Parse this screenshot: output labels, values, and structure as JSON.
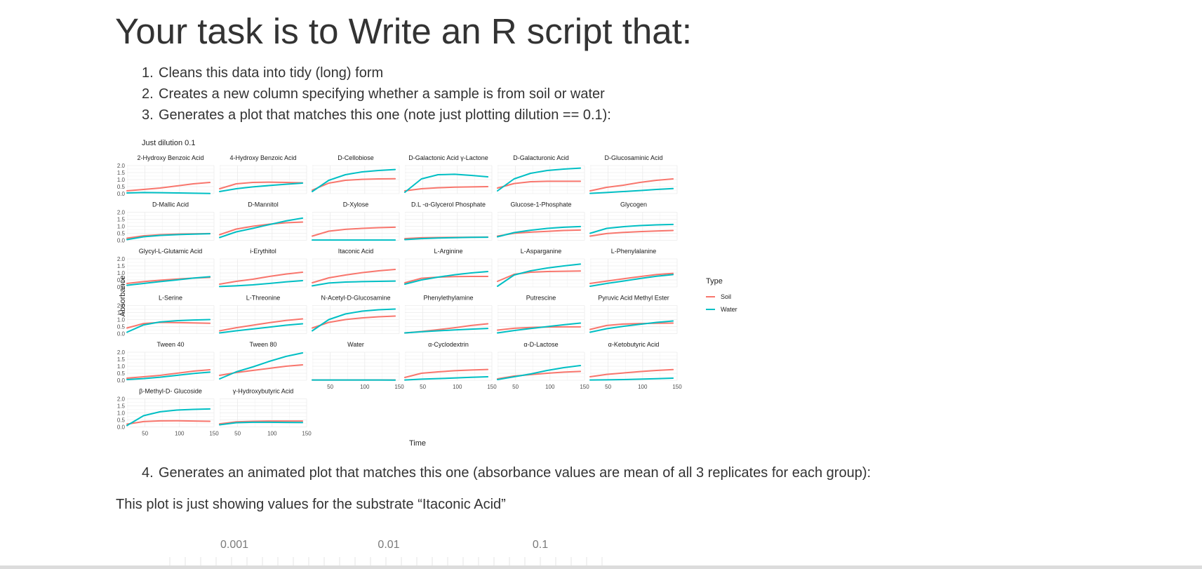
{
  "heading": "Your task is to Write an R script that:",
  "steps": [
    {
      "num": "1.",
      "text": "Cleans this data into tidy (long) form"
    },
    {
      "num": "2.",
      "text": "Creates a new column specifying whether a sample is from soil or water"
    },
    {
      "num": "3.",
      "text": "Generates a plot that matches this one (note just plotting dilution == 0.1):"
    },
    {
      "num": "4.",
      "text": "Generates an animated plot that matches this one (absorbance values are mean of all 3 replicates for each group):"
    }
  ],
  "note_text": "This plot is just showing values for the substrate “Itaconic Acid”",
  "colors": {
    "soil": "#f8766d",
    "water": "#00bfc4",
    "text": "#333333",
    "grid": "#ebebeb"
  },
  "chart_data": [
    {
      "type": "line",
      "title": "Just dilution 0.1",
      "xlabel": "Time",
      "ylabel": "Absorbance",
      "xlim": [
        24,
        150
      ],
      "ylim": [
        0,
        2
      ],
      "x_ticks": [
        50,
        100,
        150
      ],
      "y_ticks": [
        "0.0",
        "0.5",
        "1.0",
        "1.5",
        "2.0"
      ],
      "grid": true,
      "legend": {
        "title": "Type",
        "position": "right",
        "entries": [
          "Soil",
          "Water"
        ]
      },
      "x": [
        24,
        48,
        72,
        96,
        120,
        144
      ],
      "panels": [
        {
          "name": "2-Hydroxy Benzoic Acid",
          "soil": [
            0.2,
            0.3,
            0.4,
            0.55,
            0.7,
            0.8
          ],
          "water": [
            0.05,
            0.08,
            0.07,
            0.05,
            0.03,
            0.01
          ]
        },
        {
          "name": "4-Hydroxy Benzoic Acid",
          "soil": [
            0.35,
            0.7,
            0.8,
            0.82,
            0.8,
            0.77
          ],
          "water": [
            0.15,
            0.35,
            0.48,
            0.58,
            0.67,
            0.75
          ]
        },
        {
          "name": "D-Cellobiose",
          "soil": [
            0.25,
            0.75,
            0.95,
            1.02,
            1.05,
            1.06
          ],
          "water": [
            0.15,
            0.95,
            1.35,
            1.55,
            1.65,
            1.72
          ]
        },
        {
          "name": "D-Galactonic Acid γ-Lactone",
          "soil": [
            0.2,
            0.35,
            0.42,
            0.46,
            0.48,
            0.5
          ],
          "water": [
            0.1,
            1.05,
            1.35,
            1.38,
            1.3,
            1.2
          ]
        },
        {
          "name": "D-Galacturonic Acid",
          "soil": [
            0.4,
            0.72,
            0.85,
            0.88,
            0.88,
            0.88
          ],
          "water": [
            0.2,
            1.05,
            1.45,
            1.65,
            1.75,
            1.82
          ]
        },
        {
          "name": "D-Glucosaminic Acid",
          "soil": [
            0.2,
            0.45,
            0.6,
            0.8,
            0.95,
            1.05
          ],
          "water": [
            0.02,
            0.08,
            0.15,
            0.22,
            0.3,
            0.36
          ]
        },
        {
          "name": "D-Mallic Acid",
          "soil": [
            0.15,
            0.32,
            0.4,
            0.44,
            0.46,
            0.48
          ],
          "water": [
            0.05,
            0.25,
            0.35,
            0.4,
            0.44,
            0.47
          ]
        },
        {
          "name": "D-Mannitol",
          "soil": [
            0.4,
            0.8,
            1.0,
            1.15,
            1.25,
            1.3
          ],
          "water": [
            0.2,
            0.6,
            0.85,
            1.12,
            1.38,
            1.58
          ]
        },
        {
          "name": "D-Xylose",
          "soil": [
            0.3,
            0.65,
            0.78,
            0.85,
            0.9,
            0.93
          ],
          "water": [
            0.02,
            0.02,
            0.02,
            0.02,
            0.02,
            0.02
          ]
        },
        {
          "name": "D.L -α-Glycerol Phosphate",
          "soil": [
            0.12,
            0.18,
            0.2,
            0.21,
            0.22,
            0.23
          ],
          "water": [
            0.05,
            0.12,
            0.16,
            0.19,
            0.21,
            0.22
          ]
        },
        {
          "name": "Glucose-1-Phosphate",
          "soil": [
            0.3,
            0.5,
            0.58,
            0.64,
            0.7,
            0.73
          ],
          "water": [
            0.25,
            0.55,
            0.72,
            0.85,
            0.93,
            0.98
          ]
        },
        {
          "name": "Glycogen",
          "soil": [
            0.3,
            0.48,
            0.56,
            0.62,
            0.66,
            0.7
          ],
          "water": [
            0.5,
            0.85,
            0.97,
            1.05,
            1.1,
            1.13
          ]
        },
        {
          "name": "Glycyl-L-Glutamic Acid",
          "soil": [
            0.25,
            0.38,
            0.48,
            0.56,
            0.63,
            0.68
          ],
          "water": [
            0.12,
            0.25,
            0.38,
            0.5,
            0.63,
            0.73
          ]
        },
        {
          "name": "i-Erythitol",
          "soil": [
            0.2,
            0.4,
            0.55,
            0.75,
            0.92,
            1.05
          ],
          "water": [
            0.03,
            0.08,
            0.15,
            0.25,
            0.36,
            0.45
          ]
        },
        {
          "name": "Itaconic Acid",
          "soil": [
            0.3,
            0.65,
            0.85,
            1.02,
            1.15,
            1.25
          ],
          "water": [
            0.08,
            0.28,
            0.35,
            0.38,
            0.4,
            0.42
          ]
        },
        {
          "name": "L-Arginine",
          "soil": [
            0.3,
            0.62,
            0.7,
            0.74,
            0.75,
            0.75
          ],
          "water": [
            0.2,
            0.5,
            0.7,
            0.87,
            1.0,
            1.1
          ]
        },
        {
          "name": "L-Asparganine",
          "soil": [
            0.4,
            0.9,
            1.05,
            1.1,
            1.12,
            1.14
          ],
          "water": [
            0.05,
            0.85,
            1.15,
            1.35,
            1.5,
            1.63
          ]
        },
        {
          "name": "L-Phenylalanine",
          "soil": [
            0.25,
            0.42,
            0.58,
            0.74,
            0.88,
            0.97
          ],
          "water": [
            0.05,
            0.25,
            0.42,
            0.6,
            0.76,
            0.88
          ]
        },
        {
          "name": "L-Serine",
          "soil": [
            0.4,
            0.72,
            0.8,
            0.78,
            0.76,
            0.74
          ],
          "water": [
            0.1,
            0.62,
            0.83,
            0.92,
            0.97,
            1.0
          ]
        },
        {
          "name": "L-Threonine",
          "soil": [
            0.2,
            0.42,
            0.6,
            0.78,
            0.94,
            1.05
          ],
          "water": [
            0.05,
            0.2,
            0.33,
            0.46,
            0.6,
            0.7
          ]
        },
        {
          "name": "N-Acetyl-D-Glucosamine",
          "soil": [
            0.4,
            0.8,
            1.0,
            1.12,
            1.2,
            1.25
          ],
          "water": [
            0.2,
            1.0,
            1.4,
            1.6,
            1.7,
            1.75
          ]
        },
        {
          "name": "Phenylethylamine",
          "soil": [
            0.05,
            0.15,
            0.28,
            0.42,
            0.58,
            0.7
          ],
          "water": [
            0.05,
            0.13,
            0.2,
            0.26,
            0.32,
            0.37
          ]
        },
        {
          "name": "Putrescine",
          "soil": [
            0.25,
            0.38,
            0.44,
            0.47,
            0.48,
            0.48
          ],
          "water": [
            0.05,
            0.22,
            0.36,
            0.5,
            0.63,
            0.75
          ]
        },
        {
          "name": "Pyruvic Acid Methyl Ester",
          "soil": [
            0.3,
            0.58,
            0.68,
            0.72,
            0.74,
            0.75
          ],
          "water": [
            0.1,
            0.35,
            0.52,
            0.66,
            0.8,
            0.9
          ]
        },
        {
          "name": "Tween 40",
          "soil": [
            0.15,
            0.25,
            0.35,
            0.5,
            0.65,
            0.75
          ],
          "water": [
            0.05,
            0.12,
            0.22,
            0.35,
            0.48,
            0.58
          ]
        },
        {
          "name": "Tween 80",
          "soil": [
            0.35,
            0.55,
            0.7,
            0.85,
            1.0,
            1.1
          ],
          "water": [
            0.1,
            0.6,
            0.95,
            1.35,
            1.7,
            1.95
          ]
        },
        {
          "name": "Water",
          "soil": [
            0.02,
            0.02,
            0.02,
            0.02,
            0.02,
            0.02
          ],
          "water": [
            0.02,
            0.02,
            0.02,
            0.02,
            0.02,
            0.01
          ]
        },
        {
          "name": "α-Cyclodextrin",
          "soil": [
            0.2,
            0.5,
            0.6,
            0.68,
            0.73,
            0.77
          ],
          "water": [
            0.02,
            0.08,
            0.12,
            0.16,
            0.21,
            0.25
          ]
        },
        {
          "name": "α-D-Lactose",
          "soil": [
            0.1,
            0.3,
            0.4,
            0.5,
            0.58,
            0.63
          ],
          "water": [
            0.05,
            0.25,
            0.45,
            0.7,
            0.9,
            1.05
          ]
        },
        {
          "name": "α-Ketobutyric Acid",
          "soil": [
            0.25,
            0.42,
            0.52,
            0.62,
            0.7,
            0.76
          ],
          "water": [
            0.02,
            0.03,
            0.05,
            0.08,
            0.11,
            0.15
          ]
        },
        {
          "name": "β-Methyl-D- Glucoside",
          "soil": [
            0.2,
            0.38,
            0.43,
            0.44,
            0.42,
            0.4
          ],
          "water": [
            0.1,
            0.8,
            1.08,
            1.2,
            1.25,
            1.28
          ]
        },
        {
          "name": "γ-Hydroxybutyric Acid",
          "soil": [
            0.22,
            0.36,
            0.4,
            0.42,
            0.42,
            0.42
          ],
          "water": [
            0.15,
            0.3,
            0.33,
            0.33,
            0.32,
            0.31
          ]
        }
      ]
    },
    {
      "type": "line",
      "partial": true,
      "x_tick_labels": [
        "0.001",
        "0.01",
        "0.1"
      ]
    }
  ]
}
